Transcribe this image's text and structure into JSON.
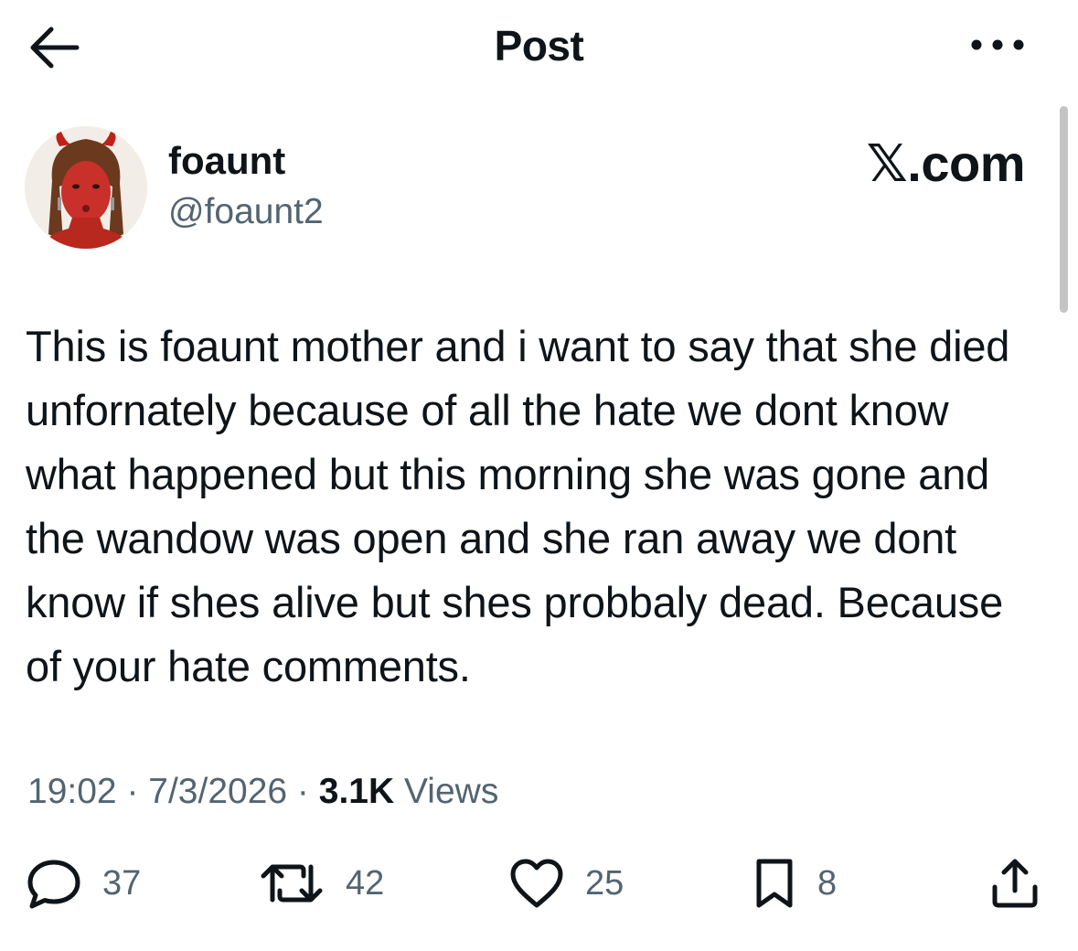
{
  "header": {
    "title": "Post",
    "back_icon": "arrow-left-icon",
    "more_icon": "more-horizontal-icon"
  },
  "author": {
    "display_name": "foaunt",
    "handle": "@foaunt2",
    "source_label": ".com",
    "source_logo_glyph": "𝕏"
  },
  "post": {
    "text": "This is foaunt mother and i want to say that she died unfornately because of all the hate we dont know what happened but this morning she was gone and the wandow was open and she ran away we dont know if shes alive but shes probbaly dead. Because of your hate comments."
  },
  "meta": {
    "time": "19:02",
    "separator": " · ",
    "date": "7/3/2026",
    "views_count": "3.1K",
    "views_label": " Views"
  },
  "actions": {
    "reply": {
      "icon": "reply-bubble-icon",
      "count": "37"
    },
    "repost": {
      "icon": "repost-icon",
      "count": "42"
    },
    "like": {
      "icon": "heart-icon",
      "count": "25"
    },
    "bookmark": {
      "icon": "bookmark-icon",
      "count": "8"
    },
    "share": {
      "icon": "share-icon"
    }
  },
  "colors": {
    "text_primary": "#0f1419",
    "text_secondary": "#536471",
    "background": "#ffffff"
  }
}
